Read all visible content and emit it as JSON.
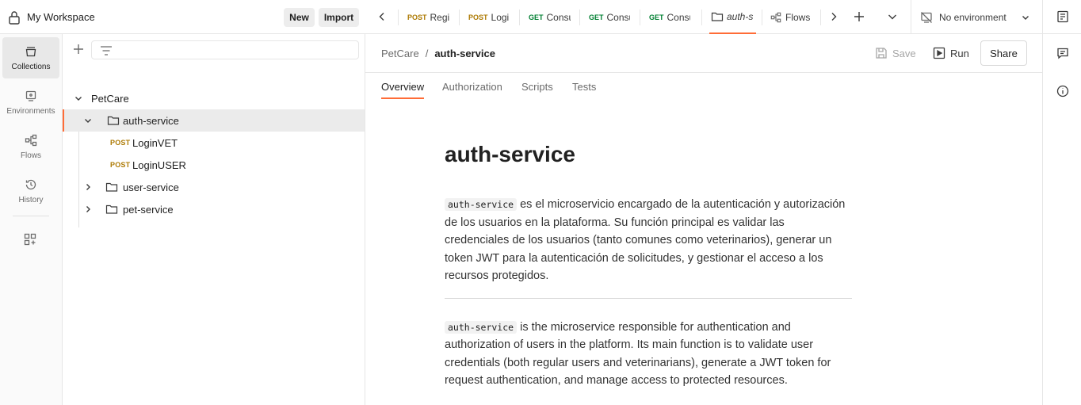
{
  "workspace": {
    "title": "My Workspace",
    "new_label": "New",
    "import_label": "Import"
  },
  "rail": {
    "items": [
      {
        "label": "Collections",
        "icon": "collections-icon",
        "active": true
      },
      {
        "label": "Environments",
        "icon": "environments-icon",
        "active": false
      },
      {
        "label": "Flows",
        "icon": "flows-icon",
        "active": false
      },
      {
        "label": "History",
        "icon": "history-icon",
        "active": false
      }
    ]
  },
  "tree": {
    "collection": "PetCare",
    "folders": [
      {
        "name": "auth-service",
        "expanded": true,
        "requests": [
          {
            "method": "POST",
            "name": "LoginVET"
          },
          {
            "method": "POST",
            "name": "LoginUSER"
          }
        ]
      },
      {
        "name": "user-service",
        "expanded": false
      },
      {
        "name": "pet-service",
        "expanded": false
      }
    ]
  },
  "tabs": {
    "items": [
      {
        "method": "POST",
        "label": "Regi"
      },
      {
        "method": "POST",
        "label": "Logi"
      },
      {
        "method": "GET",
        "label": "Consu"
      },
      {
        "method": "GET",
        "label": "Consu"
      },
      {
        "method": "GET",
        "label": "Consu"
      },
      {
        "method": "",
        "label": "auth-s",
        "active": true
      },
      {
        "method": "",
        "label": "Flows"
      }
    ],
    "environment": "No environment"
  },
  "header": {
    "breadcrumb_parent": "PetCare",
    "breadcrumb_sep": "/",
    "breadcrumb_current": "auth-service",
    "save_label": "Save",
    "run_label": "Run",
    "share_label": "Share"
  },
  "subtabs": [
    "Overview",
    "Authorization",
    "Scripts",
    "Tests"
  ],
  "doc": {
    "title": "auth-service",
    "p1_code": "auth-service",
    "p1_text": " es el microservicio encargado de la autenticación y autorización de los usuarios en la plataforma. Su función principal es validar las credenciales de los usuarios (tanto comunes como veterinarios), generar un token JWT para la autenticación de solicitudes, y gestionar el acceso a los recursos protegidos.",
    "p2_code": "auth-service",
    "p2_text": " is the microservice responsible for authentication and authorization of users in the platform. Its main function is to validate user credentials (both regular users and veterinarians), generate a JWT token for request authentication, and manage access to protected resources."
  },
  "colors": {
    "accent": "#ff6c37",
    "post": "#ad7a03",
    "get": "#007f31"
  }
}
